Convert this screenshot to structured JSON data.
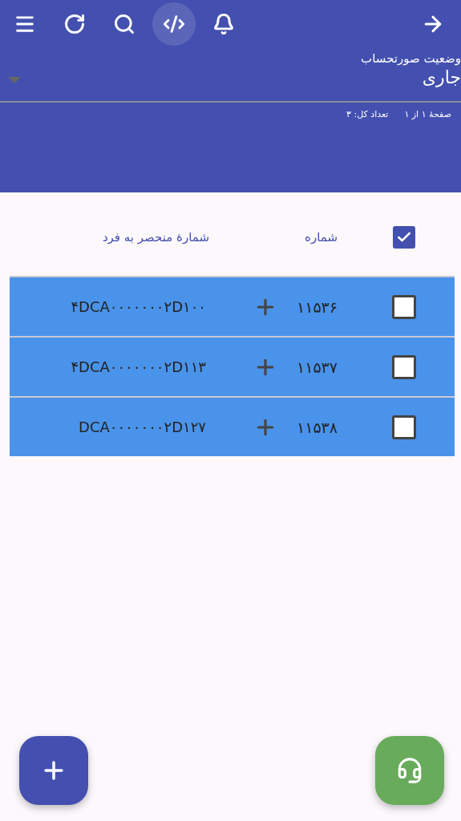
{
  "toolbar": {
    "actions": [
      {
        "selected": false
      },
      {
        "selected": false
      },
      {
        "selected": false
      },
      {
        "selected": true
      },
      {
        "selected": false
      }
    ]
  },
  "filter": {
    "label": "وضعیت صورتحساب",
    "value": "جاری"
  },
  "paging": {
    "page": "صفحهٔ ۱ از ۱",
    "total": "تعداد کل: ۳"
  },
  "table": {
    "select_all": {
      "checked": true
    },
    "columns": [
      "شماره",
      "شمارهٔ منحصر به فرد"
    ],
    "rows": [
      {
        "checked": false,
        "selected": true,
        "number": "۱۱۵۳۶",
        "unique_id": "۴DCA۰۰۰۰۰۰۰۲D۱۰۰"
      },
      {
        "checked": false,
        "selected": true,
        "number": "۱۱۵۳۷",
        "unique_id": "۴DCA۰۰۰۰۰۰۰۲D۱۱۳"
      },
      {
        "checked": false,
        "selected": true,
        "number": "۱۱۵۳۸",
        "unique_id": "DCA۰۰۰۰۰۰۰۲D۱۲۷"
      }
    ]
  }
}
